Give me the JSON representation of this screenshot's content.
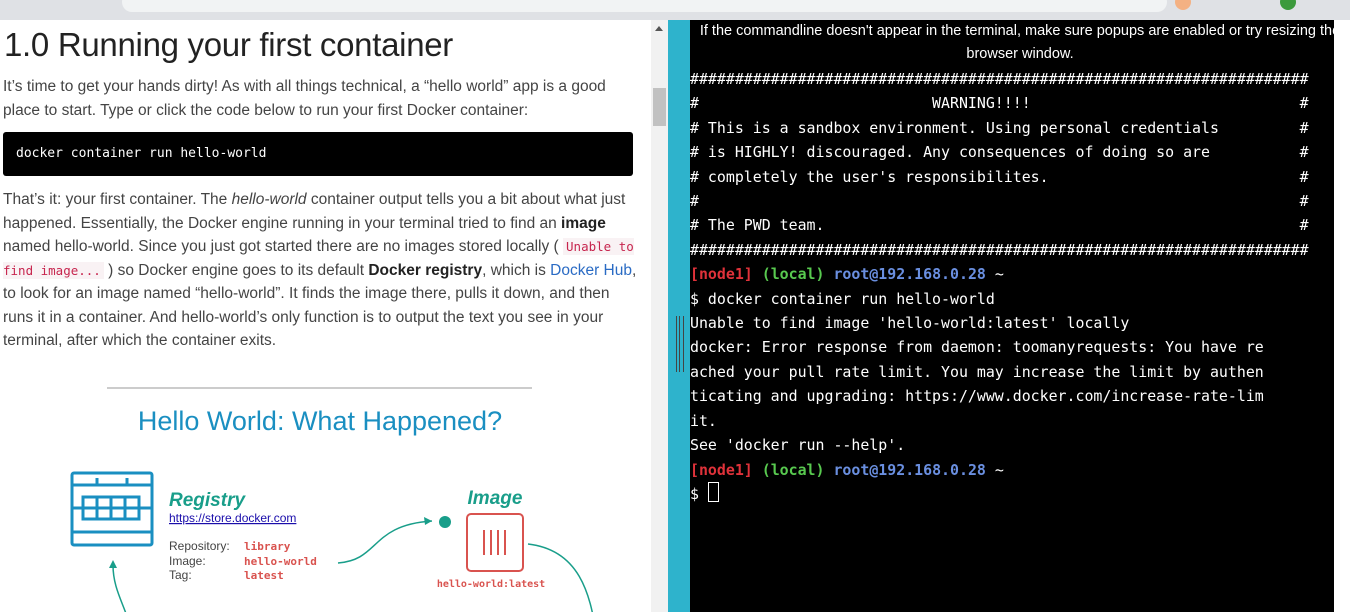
{
  "tutorial": {
    "title": "1.0 Running your first container",
    "intro": "It’s time to get your hands dirty! As with all things technical, a “hello world” app is a good place to start. Type or click the code below to run your first Docker container:",
    "code": "docker container run hello-world",
    "p2_a": "That’s it: your first container. The ",
    "p2_em": "hello-world",
    "p2_b": " container output tells you a bit about what just happened. Essentially, the Docker engine running in your terminal tried to find an ",
    "p2_strong1": "image",
    "p2_c": " named hello-world. Since you just got started there are no images stored locally ( ",
    "p2_code": "Unable to find image...",
    "p2_d": " ) so Docker engine goes to its default ",
    "p2_strong2": "Docker registry",
    "p2_e": ", which is ",
    "p2_link": "Docker Hub",
    "p2_f": ", to look for an image named “hello-world”. It finds the image there, pulls it down, and then runs it in a container. And hello-world’s only function is to output the text you see in your terminal, after which the container exits."
  },
  "diagram": {
    "title": "Hello World: What Happened?",
    "registry_label": "Registry",
    "registry_url": "https://store.docker.com",
    "repo_key": "Repository:",
    "repo_val": "library",
    "image_key": "Image:",
    "image_val": "hello-world",
    "tag_key": "Tag:",
    "tag_val": "latest",
    "image_label": "Image",
    "image_caption": "hello-world:latest",
    "colors": {
      "blue": "#1a8fc1",
      "red": "#d9534f",
      "teal": "#199e8a"
    }
  },
  "terminal": {
    "notice": "If the commandline doesn't appear in the terminal, make sure popups are enabled or try resizing the browser window.",
    "banner": [
      "#####################################################################",
      "#                          WARNING!!!!                              #",
      "# This is a sandbox environment. Using personal credentials         #",
      "# is HIGHLY! discouraged. Any consequences of doing so are          #",
      "# completely the user's responsibilites.                            #",
      "#                                                                   #",
      "# The PWD team.                                                     #",
      "#####################################################################"
    ],
    "prompt_node": "[node1]",
    "prompt_local": "(local)",
    "prompt_host": "root@192.168.0.28",
    "prompt_tilde": "~",
    "command": "$ docker container run hello-world",
    "output": [
      "Unable to find image 'hello-world:latest' locally",
      "docker: Error response from daemon: toomanyrequests: You have re",
      "ached your pull rate limit. You may increase the limit by authen",
      "ticating and upgrading: https://www.docker.com/increase-rate-lim",
      "it.",
      "See 'docker run --help'."
    ],
    "prompt_end": "$ ",
    "colors": {
      "bg": "#000000",
      "node": "#e0323a",
      "local": "#58c94f",
      "host": "#6a8fe0"
    }
  }
}
